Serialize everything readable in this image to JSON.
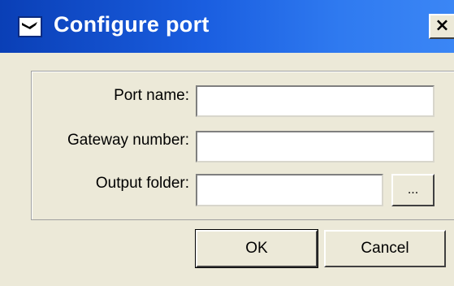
{
  "window": {
    "title": "Configure port",
    "close_glyph": "×",
    "title_icon": "port-window-icon",
    "close_icon": "close-icon",
    "titlebar_color": "#0a3fb6"
  },
  "form": {
    "port_name": {
      "label": "Port name:",
      "value": ""
    },
    "gateway_number": {
      "label": "Gateway number:",
      "value": ""
    },
    "output_folder": {
      "label": "Output folder:",
      "value": "",
      "browse_label": "..."
    }
  },
  "buttons": {
    "ok": "OK",
    "cancel": "Cancel"
  }
}
